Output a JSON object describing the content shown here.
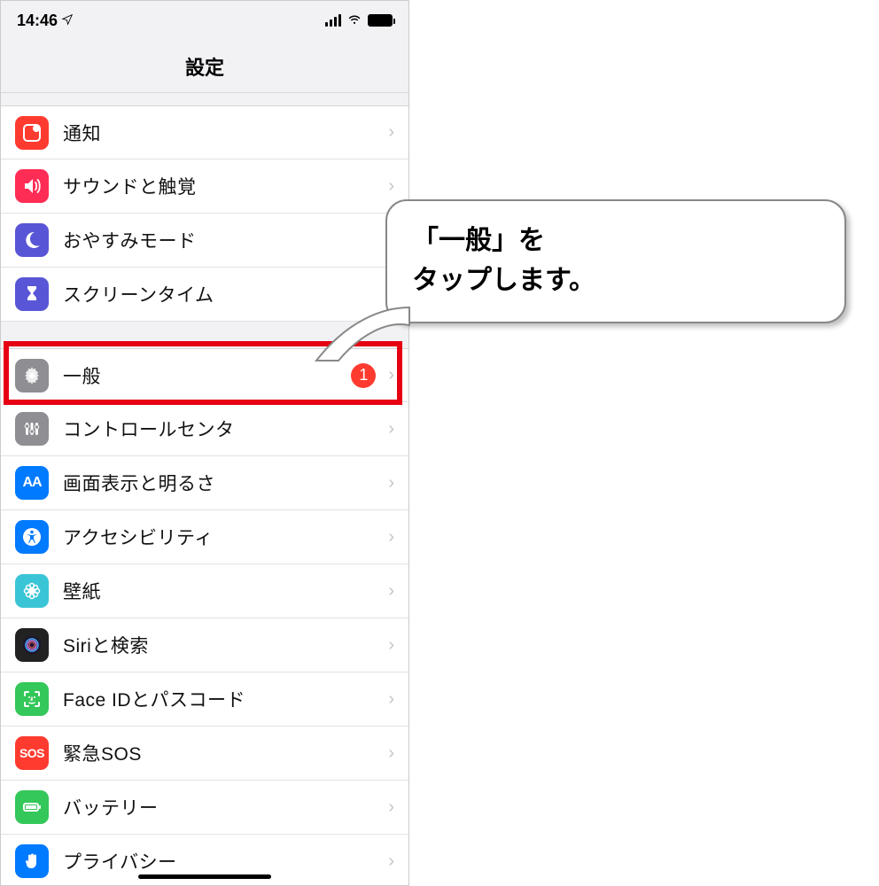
{
  "status": {
    "time": "14:46"
  },
  "nav": {
    "title": "設定"
  },
  "group1": [
    {
      "label": "通知",
      "icon": "notification",
      "bg": "bg-red"
    },
    {
      "label": "サウンドと触覚",
      "icon": "sound",
      "bg": "bg-pink"
    },
    {
      "label": "おやすみモード",
      "icon": "moon",
      "bg": "bg-purple"
    },
    {
      "label": "スクリーンタイム",
      "icon": "hourglass",
      "bg": "bg-purple"
    }
  ],
  "group2": [
    {
      "label": "一般",
      "icon": "gear",
      "bg": "bg-gray",
      "badge": "1"
    },
    {
      "label": "コントロールセンタ",
      "icon": "sliders",
      "bg": "bg-gray"
    },
    {
      "label": "画面表示と明るさ",
      "icon": "aa",
      "bg": "bg-blue"
    },
    {
      "label": "アクセシビリティ",
      "icon": "person",
      "bg": "bg-blue"
    },
    {
      "label": "壁紙",
      "icon": "flower",
      "bg": "bg-cyan"
    },
    {
      "label": "Siriと検索",
      "icon": "siri",
      "bg": "bg-dark"
    },
    {
      "label": "Face IDとパスコード",
      "icon": "faceid",
      "bg": "bg-green"
    },
    {
      "label": "緊急SOS",
      "icon": "sos",
      "bg": "bg-red",
      "iconText": "SOS"
    },
    {
      "label": "バッテリー",
      "icon": "battery",
      "bg": "bg-green"
    },
    {
      "label": "プライバシー",
      "icon": "hand",
      "bg": "bg-handblue"
    }
  ],
  "callout": {
    "line1": "「一般」を",
    "line2": "タップします。"
  }
}
